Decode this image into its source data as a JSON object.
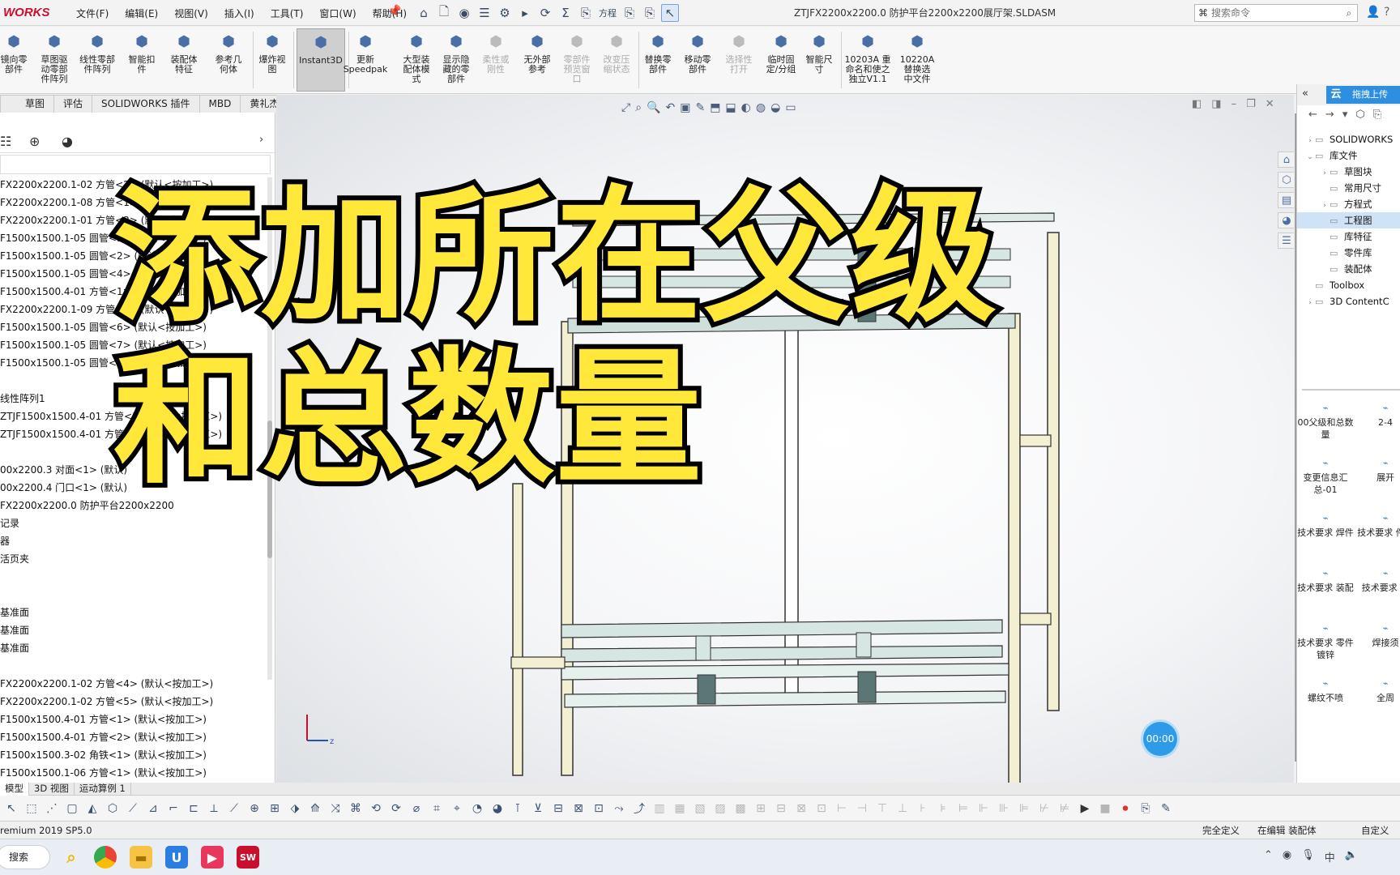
{
  "app": {
    "logo": "WORKS",
    "document_title": "ZTJFX2200x2200.0 防护平台2200x2200展厅架.SLDASM",
    "menu": [
      "文件(F)",
      "编辑(E)",
      "视图(V)",
      "插入(I)",
      "工具(T)",
      "窗口(W)",
      "帮助(H)"
    ],
    "search_placeholder": "搜索命令",
    "quick_label": "方程"
  },
  "ribbon": [
    {
      "label": "镜向零\n部件",
      "icon": "mirror-component-icon",
      "state": "normal"
    },
    {
      "label": "草图驱\n动零部\n件阵列",
      "icon": "sketch-pattern-icon",
      "state": "normal"
    },
    {
      "label": "线性零部\n件阵列",
      "icon": "linear-pattern-icon",
      "state": "normal"
    },
    {
      "label": "智能扣\n件",
      "icon": "smart-fastener-icon",
      "state": "normal"
    },
    {
      "label": "装配体\n特征",
      "icon": "assembly-feature-icon",
      "state": "normal"
    },
    {
      "label": "参考几\n何体",
      "icon": "reference-geometry-icon",
      "state": "normal"
    },
    {
      "label": "爆炸视\n图",
      "icon": "exploded-view-icon",
      "state": "normal"
    },
    {
      "label": "Instant3D",
      "icon": "instant3d-icon",
      "state": "active"
    },
    {
      "label": "更新\nSpeedpak",
      "icon": "speedpak-icon",
      "state": "normal"
    },
    {
      "label": "大型装\n配体模\n式",
      "icon": "large-assembly-icon",
      "state": "normal"
    },
    {
      "label": "显示隐\n藏的零\n部件",
      "icon": "show-hidden-icon",
      "state": "normal"
    },
    {
      "label": "柔性或\n刚性",
      "icon": "flexible-icon",
      "state": "disabled"
    },
    {
      "label": "无外部\n参考",
      "icon": "no-external-ref-icon",
      "state": "normal"
    },
    {
      "label": "零部件\n预览窗\n口",
      "icon": "preview-window-icon",
      "state": "disabled"
    },
    {
      "label": "改变压\n缩状态",
      "icon": "suppress-state-icon",
      "state": "disabled"
    },
    {
      "label": "替换零\n部件",
      "icon": "replace-component-icon",
      "state": "normal"
    },
    {
      "label": "移动零\n部件",
      "icon": "move-component-icon",
      "state": "normal"
    },
    {
      "label": "选择性\n打开",
      "icon": "selective-open-icon",
      "state": "disabled"
    },
    {
      "label": "临时固\n定/分组",
      "icon": "temp-fix-icon",
      "state": "normal"
    },
    {
      "label": "智能尺\n寸",
      "icon": "smart-dimension-icon",
      "state": "normal"
    },
    {
      "label": "10203A 重\n命名和使之\n独立V1.1",
      "icon": "rename-macro-icon",
      "state": "normal"
    },
    {
      "label": "10220A\n替换选\n中文件",
      "icon": "replace-file-macro-icon",
      "state": "normal"
    }
  ],
  "tabs": [
    "草图",
    "评估",
    "SOLIDWORKS 插件",
    "MBD",
    "黄礼杰"
  ],
  "tree": [
    "FX2200x2200.1-02 方管<2> (默认<按加工>)",
    "FX2200x2200.1-08 方管<1> (默认<按加工>)",
    "FX2200x2200.1-01 方管<2> (默认<按加工>)",
    "F1500x1500.1-05 圆管<1> (默认<按加工>)",
    "F1500x1500.1-05 圆管<2> (默认<按加工>)",
    "F1500x1500.1-05 圆管<4> (默认<按加工>)",
    "F1500x1500.4-01 方管<1> (默认<按加工>)",
    "FX2200x2200.1-09 方管<1> (默认<按加工>)",
    "F1500x1500.1-05 圆管<6> (默认<按加工>)",
    "F1500x1500.1-05 圆管<7> (默认<按加工>)",
    "F1500x1500.1-05 圆管<8> (默认<按加工>)",
    "",
    "线性阵列1",
    "ZTJF1500x1500.4-01 方管<1> (默认<按加工>)",
    "ZTJF1500x1500.4-01 方管<2> (默认<按加工>)",
    "",
    "00x2200.3 对面<1> (默认)",
    "00x2200.4 门口<1> (默认)",
    "FX2200x2200.0 防护平台2200x2200",
    "记录",
    "器",
    "活页夹",
    "",
    "",
    "基准面",
    "基准面",
    "基准面",
    "",
    "FX2200x2200.1-02 方管<4> (默认<按加工>)",
    "FX2200x2200.1-02 方管<5> (默认<按加工>)",
    "F1500x1500.4-01 方管<1> (默认<按加工>)",
    "F1500x1500.4-01 方管<2> (默认<按加工>)",
    "F1500x1500.3-02 角铁<1> (默认<按加工>)",
    "F1500x1500.1-06 方管<1> (默认<按加工>)"
  ],
  "caption": {
    "line1": "添加所在父级",
    "line2": "和总数量"
  },
  "timer": "00:00",
  "taskpane": {
    "logo": "云",
    "upload": "拖拽上传",
    "tree": [
      {
        "label": "SOLIDWORKS",
        "twisty": "›",
        "depth": 0
      },
      {
        "label": "库文件",
        "twisty": "⌄",
        "depth": 0
      },
      {
        "label": "草图块",
        "twisty": "›",
        "depth": 1
      },
      {
        "label": "常用尺寸",
        "twisty": "",
        "depth": 1
      },
      {
        "label": "方程式",
        "twisty": "›",
        "depth": 1
      },
      {
        "label": "工程图",
        "twisty": "",
        "depth": 1,
        "selected": true
      },
      {
        "label": "库特征",
        "twisty": "",
        "depth": 1
      },
      {
        "label": "零件库",
        "twisty": "",
        "depth": 1
      },
      {
        "label": "装配体",
        "twisty": "",
        "depth": 1
      },
      {
        "label": "Toolbox",
        "twisty": "",
        "depth": 0
      },
      {
        "label": "3D ContentC",
        "twisty": "›",
        "depth": 0
      }
    ],
    "grid": [
      "00父级和总数量",
      "2-4",
      "变更信息汇总-01",
      "展开",
      "技术要求 焊件",
      "技术要求 件镀",
      "技术要求 装配",
      "技术要求 件",
      "技术要求 零件镀锌",
      "焊接须",
      "螺纹不喷",
      "全周"
    ]
  },
  "view_tabs": [
    "模型",
    "3D 视图",
    "运动算例 1"
  ],
  "status": {
    "left": "remium 2019 SP5.0",
    "fully_defined": "完全定义",
    "editing": "在编辑 装配体",
    "custom": "自定义"
  },
  "taskbar": {
    "search": "搜索"
  }
}
